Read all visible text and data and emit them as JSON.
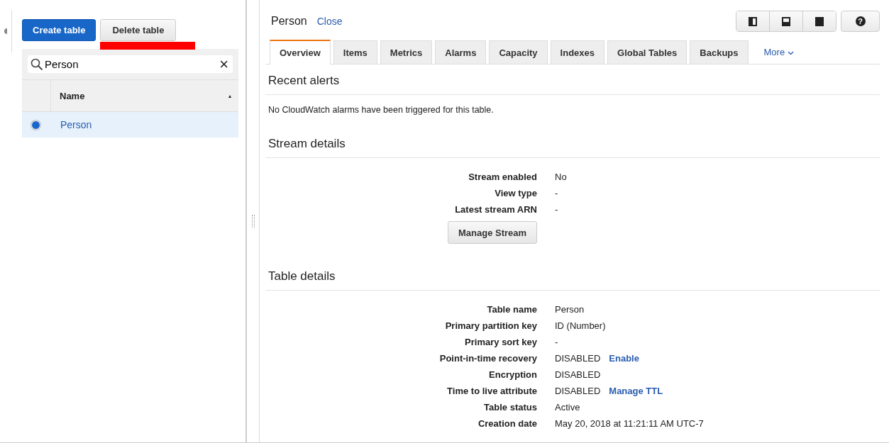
{
  "sidebar": {
    "create_button": "Create table",
    "delete_button": "Delete table",
    "search": {
      "value": "Person",
      "clear": "×"
    },
    "table": {
      "column": "Name",
      "sort": "▴",
      "rows": [
        {
          "name": "Person",
          "selected": true
        }
      ]
    }
  },
  "panel": {
    "title": "Person",
    "close": "Close",
    "help": "?",
    "tabs": [
      {
        "label": "Overview",
        "selected": true
      },
      {
        "label": "Items",
        "selected": false
      },
      {
        "label": "Metrics",
        "selected": false
      },
      {
        "label": "Alarms",
        "selected": false
      },
      {
        "label": "Capacity",
        "selected": false
      },
      {
        "label": "Indexes",
        "selected": false
      },
      {
        "label": "Global Tables",
        "selected": false
      },
      {
        "label": "Backups",
        "selected": false
      }
    ],
    "more": "More",
    "sections": [
      {
        "title": "Recent alerts",
        "text": "No CloudWatch alarms have been triggered for this table."
      },
      {
        "title": "Stream details",
        "rows": [
          {
            "label": "Stream enabled",
            "value": "No"
          },
          {
            "label": "View type",
            "value": "-"
          },
          {
            "label": "Latest stream ARN",
            "value": "-"
          }
        ],
        "button": "Manage Stream"
      },
      {
        "title": "Table details",
        "rows": [
          {
            "label": "Table name",
            "value": "Person"
          },
          {
            "label": "Primary partition key",
            "value": "ID (Number)"
          },
          {
            "label": "Primary sort key",
            "value": "-"
          },
          {
            "label": "Point-in-time recovery",
            "value": "DISABLED",
            "link": "Enable"
          },
          {
            "label": "Encryption",
            "value": "DISABLED"
          },
          {
            "label": "Time to live attribute",
            "value": "DISABLED",
            "link": "Manage TTL"
          },
          {
            "label": "Table status",
            "value": "Active"
          },
          {
            "label": "Creation date",
            "value": "May 20, 2018 at 11:21:11 AM UTC-7"
          }
        ]
      }
    ]
  }
}
